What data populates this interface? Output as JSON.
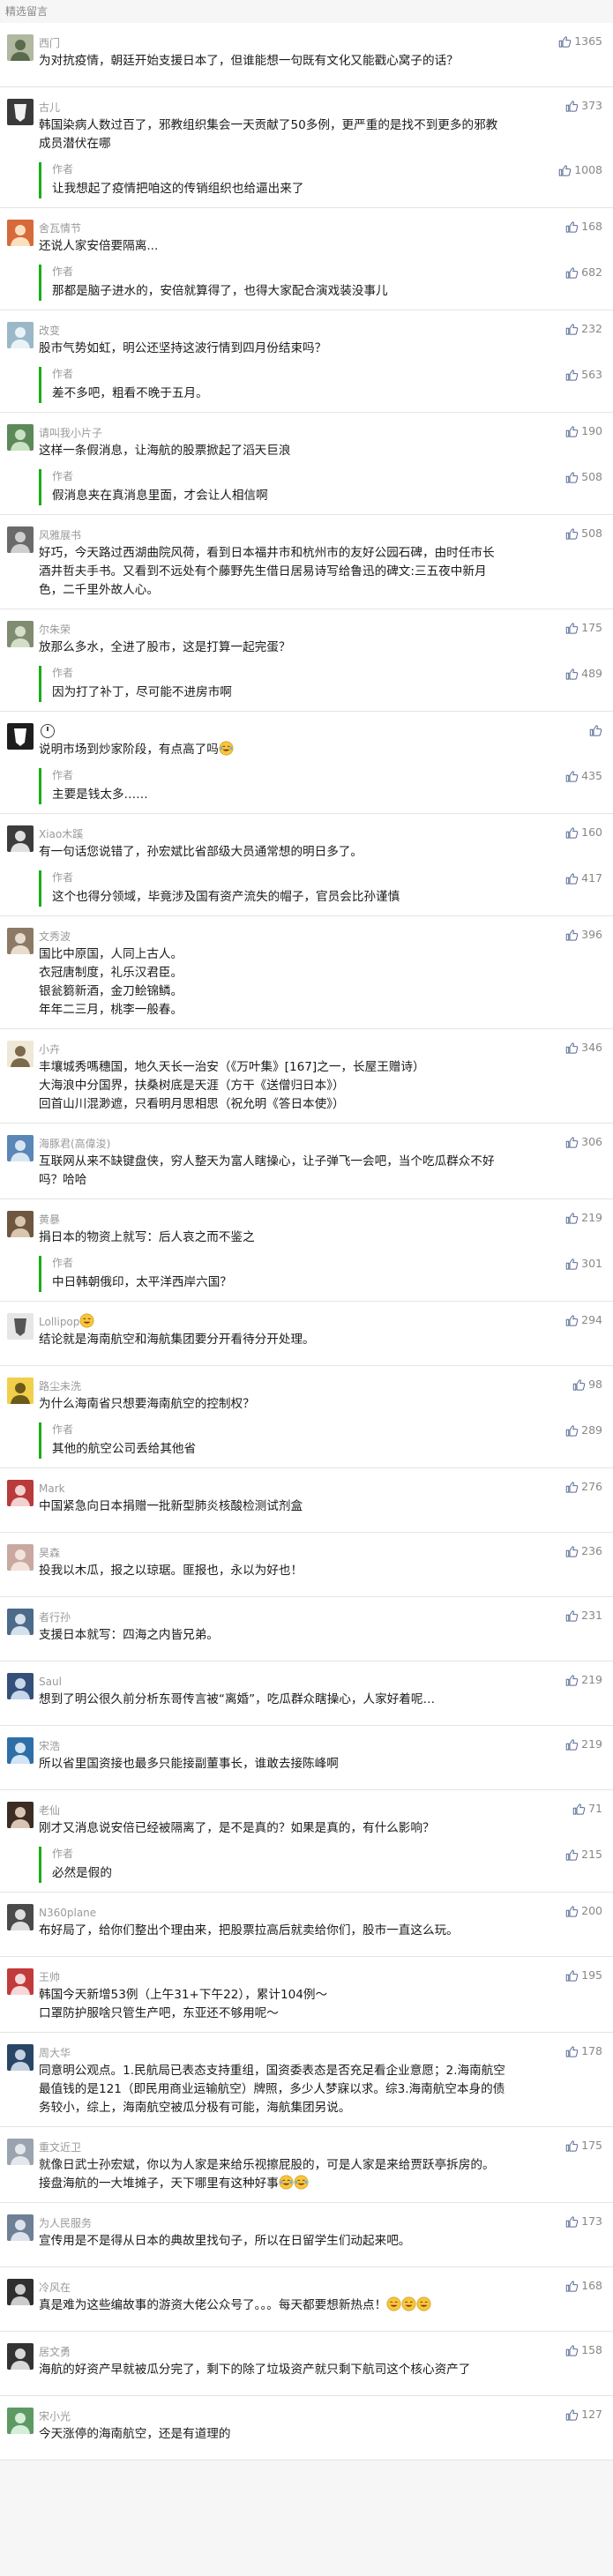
{
  "section_title": "精选留言",
  "author_label": "作者",
  "colors": {
    "accent_green": "#1aad19",
    "like_icon": "#576b95",
    "meta_gray": "#9a9a9a"
  },
  "comments": [
    {
      "nickname": "西门",
      "avatar": {
        "bg": "#b0b8a0",
        "fg": "#5a6a4a",
        "icon": "photo-avatar"
      },
      "likes": "1365",
      "content": [
        "为对抗疫情，朝廷开始支援日本了，但谁能想一句既有文化又能戳心窝子的话？"
      ],
      "reply": null
    },
    {
      "nickname": "古儿",
      "avatar": {
        "bg": "#3a3a3a",
        "fg": "#f2f2f2",
        "icon": "mask-avatar"
      },
      "likes": "373",
      "content": [
        "韩国染病人数过百了，邪教组织集会一天贡献了50多例，更严重的是找不到更多的邪教成员潜伏在哪"
      ],
      "reply": {
        "content": [
          "让我想起了疫情把咱这的传销组织也给逼出来了"
        ],
        "likes": "1008"
      }
    },
    {
      "nickname": "舍瓦情节",
      "avatar": {
        "bg": "#d66a3a",
        "fg": "#fbe0c0",
        "icon": "photo-avatar"
      },
      "likes": "168",
      "content": [
        "还说人家安倍要隔离..."
      ],
      "reply": {
        "content": [
          "那都是脑子进水的，安倍就算得了，也得大家配合演戏装没事儿"
        ],
        "likes": "682"
      }
    },
    {
      "nickname": "改变",
      "avatar": {
        "bg": "#9ab8c8",
        "fg": "#e9f2f6",
        "icon": "photo-avatar"
      },
      "likes": "232",
      "content": [
        "股市气势如虹，明公还坚持这波行情到四月份结束吗？"
      ],
      "reply": {
        "content": [
          "差不多吧，粗看不晚于五月。"
        ],
        "likes": "563"
      }
    },
    {
      "nickname": "请叫我小片子",
      "avatar": {
        "bg": "#5b8a58",
        "fg": "#c9e1c4",
        "icon": "photo-avatar"
      },
      "likes": "190",
      "content": [
        "这样一条假消息，让海航的股票掀起了滔天巨浪"
      ],
      "reply": {
        "content": [
          "假消息夹在真消息里面，才会让人相信啊"
        ],
        "likes": "508"
      }
    },
    {
      "nickname": "风雅展书",
      "avatar": {
        "bg": "#6a6a6a",
        "fg": "#cfcfcf",
        "icon": "photo-avatar"
      },
      "likes": "508",
      "content": [
        "好巧，今天路过西湖曲院风荷，看到日本福井市和杭州市的友好公园石碑，由时任市长酒井哲夫手书。又看到不远处有个藤野先生借日居易诗写给鲁迅的碑文:三五夜中新月色，二千里外故人心。"
      ],
      "reply": null
    },
    {
      "nickname": "尔朱荣",
      "avatar": {
        "bg": "#7f8c70",
        "fg": "#d5dec8",
        "icon": "photo-avatar"
      },
      "likes": "175",
      "content": [
        "放那么多水，全进了股市，这是打算一起完蛋？"
      ],
      "reply": {
        "content": [
          "因为打了补丁，尽可能不进房市啊"
        ],
        "likes": "489"
      }
    },
    {
      "nickname": "",
      "nickname_clock": true,
      "avatar": {
        "bg": "#1e1e1e",
        "fg": "#ffffff",
        "icon": "mask-avatar"
      },
      "likes": "",
      "content": [
        "说明市场到炒家阶段，有点高了吗"
      ],
      "content_emoji": "laugh-tears",
      "reply": {
        "content": [
          "主要是钱太多……"
        ],
        "likes": "435"
      }
    },
    {
      "nickname": "Xiao木蹊",
      "avatar": {
        "bg": "#3c3c3c",
        "fg": "#e0e0e0",
        "icon": "photo-avatar"
      },
      "likes": "160",
      "content": [
        "有一句话您说错了，孙宏斌比省部级大员通常想的明日多了。"
      ],
      "reply": {
        "content": [
          "这个也得分领域，毕竟涉及国有资产流失的帽子，官员会比孙谨慎"
        ],
        "likes": "417"
      }
    },
    {
      "nickname": "文秀波",
      "avatar": {
        "bg": "#8c7a66",
        "fg": "#e8dccf",
        "icon": "photo-avatar"
      },
      "likes": "396",
      "content": [
        "国比中原国，人同上古人。",
        "衣冠唐制度，礼乐汉君臣。",
        "银瓮篘新酒，金刀鲙锦鳞。",
        "年年二三月，桃李一般春。"
      ],
      "reply": null
    },
    {
      "nickname": "小卉",
      "avatar": {
        "bg": "#f0e8d6",
        "fg": "#7a6a4a",
        "icon": "photo-avatar"
      },
      "likes": "346",
      "content": [
        "丰壤城秀嗎穗国，地久天长一治安（《万叶集》[167]之一，长屋王赠诗）",
        "大海浪中分国界，扶桑树底是天涯（方干《送僧归日本》）",
        "回首山川混渺遮，只看明月思相思（祝允明《答日本使》）"
      ],
      "reply": null
    },
    {
      "nickname": "海豚君(高偉浚)",
      "avatar": {
        "bg": "#5a86b8",
        "fg": "#d8e6f4",
        "icon": "photo-avatar"
      },
      "likes": "306",
      "content": [
        "互联网从来不缺键盘侠，穷人整天为富人瞎操心，让子弹飞一会吧，当个吃瓜群众不好吗？哈哈"
      ],
      "reply": null
    },
    {
      "nickname": "黄暴",
      "avatar": {
        "bg": "#6e5640",
        "fg": "#d9c6ae",
        "icon": "photo-avatar"
      },
      "likes": "219",
      "content": [
        "捐日本的物资上就写：后人哀之而不鉴之"
      ],
      "reply": {
        "content": [
          "中日韩朝俄印，太平洋西岸六国？"
        ],
        "likes": "301"
      }
    },
    {
      "nickname": "Lollipop",
      "nickname_emoji": "grin",
      "avatar": {
        "bg": "#e6e6e6",
        "fg": "#555555",
        "icon": "mask-avatar"
      },
      "likes": "294",
      "content": [
        "结论就是海南航空和海航集团要分开看待分开处理。"
      ],
      "reply": null
    },
    {
      "nickname": "路尘未洗",
      "avatar": {
        "bg": "#f1cf4a",
        "fg": "#6b5a1a",
        "icon": "photo-avatar"
      },
      "likes": "98",
      "content": [
        "为什么海南省只想要海南航空的控制权？"
      ],
      "reply": {
        "content": [
          "其他的航空公司丢给其他省"
        ],
        "likes": "289"
      }
    },
    {
      "nickname": "Mark",
      "avatar": {
        "bg": "#b83a3a",
        "fg": "#f4d0d0",
        "icon": "photo-avatar"
      },
      "likes": "276",
      "content": [
        "中国紧急向日本捐赠一批新型肺炎核酸检测试剂盒"
      ],
      "reply": null
    },
    {
      "nickname": "昊森",
      "avatar": {
        "bg": "#c9a8a0",
        "fg": "#f2e2dc",
        "icon": "photo-avatar"
      },
      "likes": "236",
      "content": [
        "投我以木瓜，报之以琼琚。匪报也，永以为好也！"
      ],
      "reply": null
    },
    {
      "nickname": "者行孙",
      "avatar": {
        "bg": "#4c6a8a",
        "fg": "#d4e0ec",
        "icon": "photo-avatar"
      },
      "likes": "231",
      "content": [
        "支援日本就写：四海之内皆兄弟。"
      ],
      "reply": null
    },
    {
      "nickname": "Saul",
      "avatar": {
        "bg": "#34507a",
        "fg": "#c8d6ea",
        "icon": "photo-avatar"
      },
      "likes": "219",
      "content": [
        "想到了明公很久前分析东哥传言被“离婚”，吃瓜群众瞎操心，人家好着呢…"
      ],
      "reply": null
    },
    {
      "nickname": "宋浩",
      "avatar": {
        "bg": "#2e6fa8",
        "fg": "#d3e4f4",
        "icon": "photo-avatar"
      },
      "likes": "219",
      "content": [
        "所以省里国资接也最多只能接副董事长，谁敢去接陈峰啊"
      ],
      "reply": null
    },
    {
      "nickname": "老仙",
      "avatar": {
        "bg": "#3c2c24",
        "fg": "#d9c4b4",
        "icon": "photo-avatar"
      },
      "likes": "71",
      "content": [
        "刚才又消息说安倍已经被隔离了，是不是真的？如果是真的，有什么影响？"
      ],
      "reply": {
        "content": [
          "必然是假的"
        ],
        "likes": "215"
      }
    },
    {
      "nickname": "N360plane",
      "avatar": {
        "bg": "#4a4a4a",
        "fg": "#dddddd",
        "icon": "photo-avatar"
      },
      "likes": "200",
      "content": [
        "布好局了，给你们整出个理由来，把股票拉高后就卖给你们，股市一直这么玩。"
      ],
      "reply": null
    },
    {
      "nickname": "王帅",
      "avatar": {
        "bg": "#c23a3a",
        "fg": "#f6d8d8",
        "icon": "photo-avatar"
      },
      "likes": "195",
      "content": [
        "韩国今天新增53例（上午31+下午22），累计104例～",
        "口罩防护服啥只管生产吧，东亚还不够用呢～"
      ],
      "reply": null
    },
    {
      "nickname": "周大华",
      "avatar": {
        "bg": "#2a4666",
        "fg": "#c4d2e2",
        "icon": "photo-avatar"
      },
      "likes": "178",
      "content": [
        "同意明公观点。1.民航局已表态支持重组，国资委表态是否充足看企业意愿；2.海南航空最值钱的是121（即民用商业运输航空）牌照，多少人梦寐以求。综3.海南航空本身的债务较小，综上，海南航空被瓜分极有可能，海航集团另说。"
      ],
      "reply": null
    },
    {
      "nickname": "重文近卫",
      "avatar": {
        "bg": "#9aa4b0",
        "fg": "#e4e8ec",
        "icon": "photo-avatar"
      },
      "likes": "175",
      "content": [
        "就像日武士孙宏斌，你以为人家是来给乐视擦屁股的，可是人家是来给贾跃亭拆房的。接盘海航的一大堆摊子，天下哪里有这种好事"
      ],
      "content_emoji": "laugh-tears",
      "content_emoji_count": 2,
      "reply": null
    },
    {
      "nickname": "为人民服务",
      "avatar": {
        "bg": "#6f8096",
        "fg": "#dce3ec",
        "icon": "photo-avatar"
      },
      "likes": "173",
      "content": [
        "宣传用是不是得从日本的典故里找句子，所以在日留学生们动起来吧。"
      ],
      "reply": null
    },
    {
      "nickname": "冷风在",
      "avatar": {
        "bg": "#2f2f2f",
        "fg": "#cccccc",
        "icon": "photo-avatar"
      },
      "likes": "168",
      "content": [
        "真是难为这些编故事的游资大佬公众号了。。。每天都要想新热点！"
      ],
      "content_emoji": "smile",
      "content_emoji_count": 3,
      "reply": null
    },
    {
      "nickname": "居文勇",
      "avatar": {
        "bg": "#333333",
        "fg": "#d8d8d8",
        "icon": "photo-avatar"
      },
      "likes": "158",
      "content": [
        "海航的好资产早就被瓜分完了，剩下的除了垃圾资产就只剩下航司这个核心资产了"
      ],
      "reply": null
    },
    {
      "nickname": "宋小光",
      "avatar": {
        "bg": "#5d9a63",
        "fg": "#d6eed8",
        "icon": "photo-avatar"
      },
      "likes": "127",
      "content": [
        "今天涨停的海南航空，还是有道理的"
      ],
      "reply": null
    }
  ]
}
